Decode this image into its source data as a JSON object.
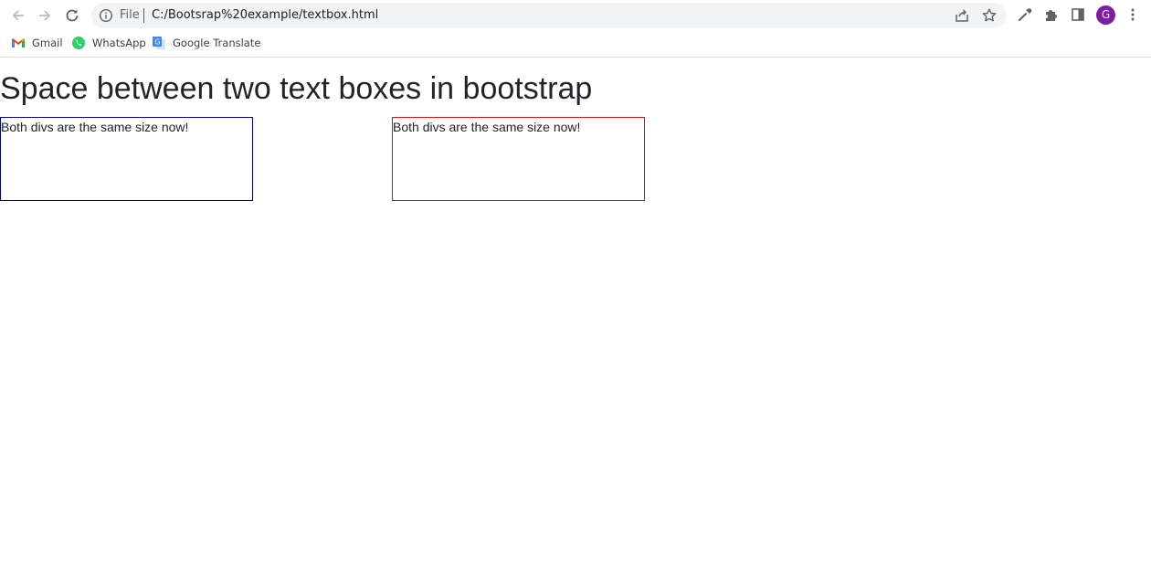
{
  "browser": {
    "omnibox": {
      "scheme_label": "File",
      "url": "C:/Bootsrap%20example/textbox.html"
    },
    "profile_initial": "G",
    "profile_color": "#7b1fa2",
    "bookmarks": [
      {
        "label": "Gmail",
        "icon": "gmail-icon"
      },
      {
        "label": "WhatsApp",
        "icon": "whatsapp-icon"
      },
      {
        "label": "Google Translate",
        "icon": "google-translate-icon"
      }
    ]
  },
  "page": {
    "title": "Space between two text boxes in bootstrap",
    "boxes": [
      {
        "text": "Both divs are the same size now!",
        "border_color": "#0000a0"
      },
      {
        "text": "Both divs are the same size now!",
        "border_color": "#e01010"
      }
    ]
  }
}
